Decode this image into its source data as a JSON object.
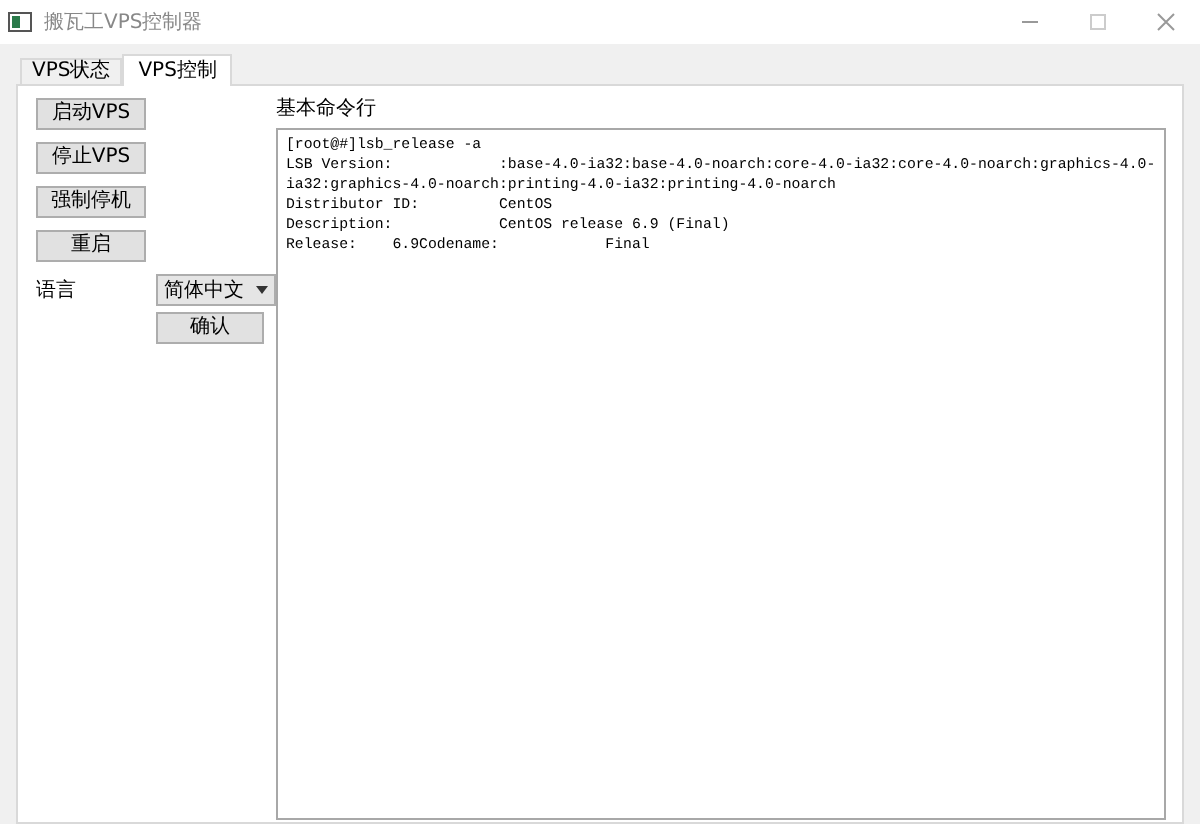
{
  "window": {
    "title": "搬瓦工VPS控制器"
  },
  "tabs": [
    {
      "label": "VPS状态",
      "selected": false
    },
    {
      "label": "VPS控制",
      "selected": true
    }
  ],
  "actions": [
    "启动VPS",
    "停止VPS",
    "强制停机",
    "重启"
  ],
  "language": {
    "label": "语言",
    "value": "简体中文",
    "confirm": "确认"
  },
  "console": {
    "title": "基本命令行",
    "lines": [
      "[root@#]lsb_release -a",
      "LSB Version:\t:base-4.0-ia32:base-4.0-noarch:core-4.0-ia32:core-4.0-noarch:graphics-4.0-",
      "ia32:graphics-4.0-noarch:printing-4.0-ia32:printing-4.0-noarch",
      "Distributor ID:\tCentOS",
      "Description:\tCentOS release 6.9 (Final)",
      "Release:\t6.9Codename:\tFinal"
    ]
  }
}
